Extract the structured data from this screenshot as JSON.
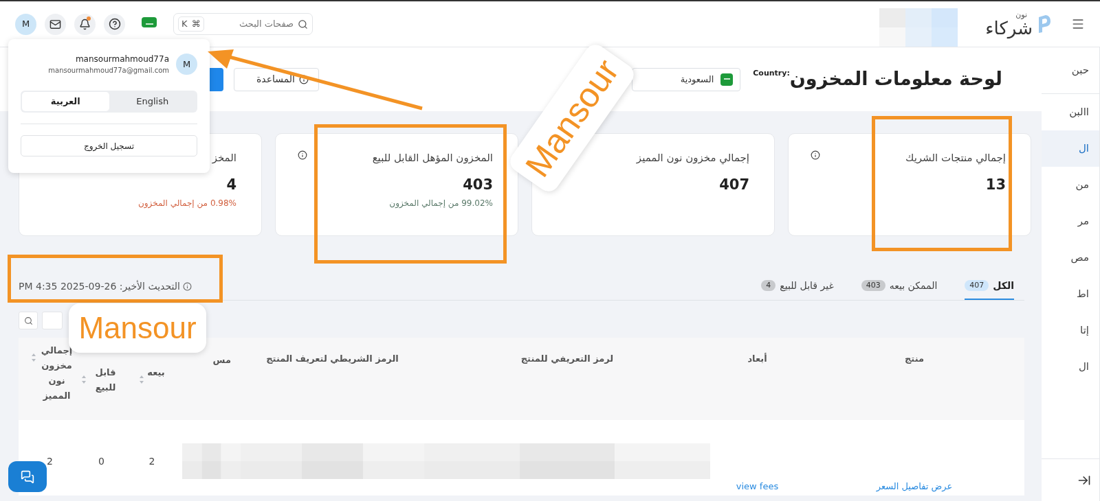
{
  "topbar": {
    "search": {
      "placeholder": "صفحات البحث",
      "keys": [
        "⌘",
        "K"
      ]
    },
    "avatar": "M",
    "notification_dot": true,
    "logo": {
      "brand": "شركاء",
      "sub": "نون"
    }
  },
  "sidebar": {
    "items": [
      {
        "label": "حبن",
        "selected": false
      },
      {
        "label": "االبن",
        "selected": false
      },
      {
        "label": "ال",
        "selected": true
      },
      {
        "label": "من",
        "selected": false
      },
      {
        "label": "مر",
        "selected": false
      },
      {
        "label": "مص",
        "selected": false
      },
      {
        "label": "اط",
        "selected": false
      },
      {
        "label": "إتا",
        "selected": false
      },
      {
        "label": "ال",
        "selected": false
      }
    ]
  },
  "page": {
    "title": "لوحة معلومات المخزون",
    "country_label": "Country:",
    "country": "السعودية",
    "help_button": "المساعدة"
  },
  "cards": [
    {
      "title": "إجمالي منتجات الشريك",
      "value": "13",
      "info": true
    },
    {
      "title": "إجمالي مخزون نون المميز",
      "value": "407"
    },
    {
      "title": "المخزون المؤهل القابل للبيع",
      "value": "403",
      "info": true,
      "note": "99.02% من إجمالي المخزون",
      "color": "#5b7a6a"
    },
    {
      "title": "المخز",
      "value": "4",
      "note": "0.98% من إجمالي المخزون",
      "color": "#d2603f"
    }
  ],
  "last_update": "التحديث الأخير: 26-09-2025 4:35 PM",
  "tabs": [
    {
      "label": "الكل",
      "count": "407",
      "selected": true
    },
    {
      "label": "الممكن بيعه",
      "count": "403",
      "selected": false
    },
    {
      "label": "غير قابل للبيع",
      "count": "4",
      "selected": false
    }
  ],
  "table": {
    "columns": [
      {
        "label": "منتج"
      },
      {
        "label": "أبعاد"
      },
      {
        "label": "لرمز التعريفي للمنتج"
      },
      {
        "label": "الرمز الشريطي لتعريف المنتج"
      },
      {
        "label": "مس"
      },
      {
        "label": "بيعه",
        "sortable": true
      },
      {
        "label": "قابل للبيع",
        "sortable": true
      },
      {
        "label": "إجمالي مخزون نون المميز",
        "sortable": true
      }
    ],
    "rows": [
      {
        "cells": [
          {
            "kind": "link",
            "text": "عرض تفاصيل السعر"
          },
          {
            "kind": "link",
            "text": "view fees"
          },
          {
            "kind": "blurred"
          },
          {
            "kind": "blurred"
          },
          {
            "kind": "blurred"
          },
          {
            "kind": "text",
            "text": "2"
          },
          {
            "kind": "text",
            "text": "0"
          },
          {
            "kind": "text",
            "text": "2"
          }
        ]
      }
    ]
  },
  "account_menu": {
    "username": "mansourmahmoud77a",
    "email": "mansourmahmoud77a@gmail.com",
    "avatar": "M",
    "languages": [
      {
        "label": "English",
        "selected": false
      },
      {
        "label": "العربية",
        "selected": true
      }
    ],
    "logout": "تسجيل الخروج"
  },
  "annotations": [
    {
      "kind": "box"
    },
    {
      "kind": "box"
    },
    {
      "kind": "box"
    },
    {
      "kind": "arrow"
    },
    {
      "kind": "label",
      "text": "Mansour",
      "rotated": true
    },
    {
      "kind": "label",
      "text": "Mansour",
      "rotated": false
    }
  ]
}
